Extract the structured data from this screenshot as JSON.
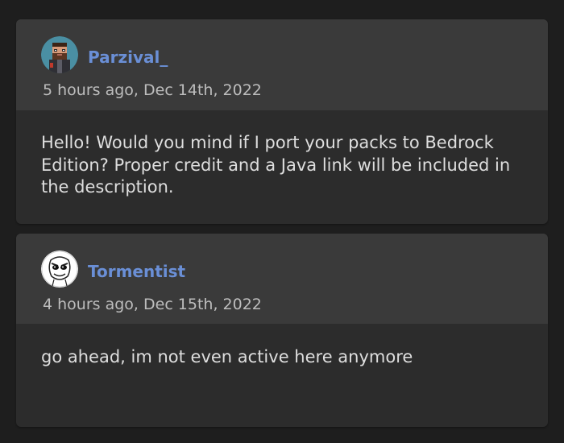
{
  "comments": [
    {
      "username": "Parzival_",
      "timestamp": "5 hours ago, Dec 14th, 2022",
      "body": "Hello! Would you mind if I port your packs to Bedrock Edition? Proper credit and a Java link will be included in the description.",
      "avatar_icon": "pixel-art-bearded-man-avatar"
    },
    {
      "username": "Tormentist",
      "timestamp": "4 hours ago, Dec 15th, 2022",
      "body": "go ahead, im not even active here anymore",
      "avatar_icon": "troll-face-sketch-avatar"
    }
  ],
  "colors": {
    "page_background": "#1e1e1e",
    "card_header": "#3a3a3a",
    "card_body": "#2c2c2c",
    "username": "#6a8fd6",
    "timestamp": "#bdbdbd",
    "body_text": "#dedede"
  }
}
